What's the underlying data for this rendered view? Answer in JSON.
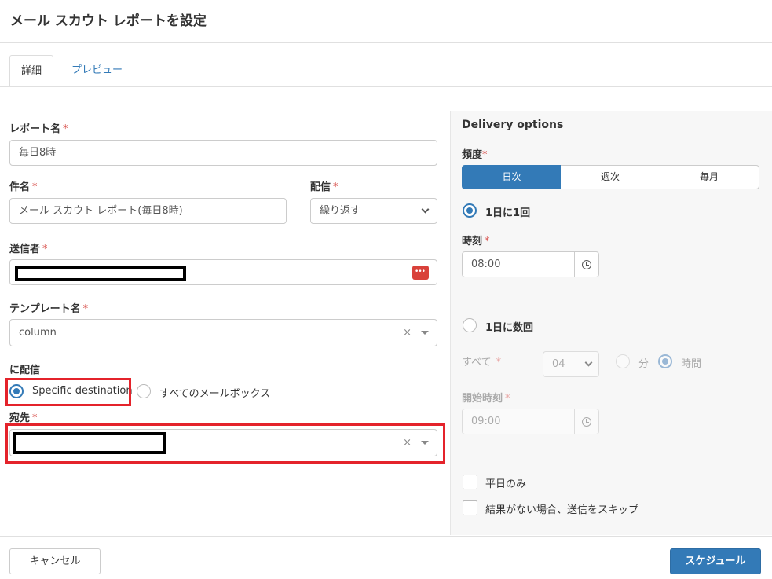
{
  "dialog": {
    "title": "メール スカウト レポートを設定"
  },
  "tabs": [
    {
      "label": "詳細",
      "active": true
    },
    {
      "label": "プレビュー",
      "active": false
    }
  ],
  "form": {
    "report_name": {
      "label": "レポート名",
      "required": "*",
      "value": "毎日8時"
    },
    "subject": {
      "label": "件名",
      "required": "*",
      "value": "メール スカウト レポート(毎日8時)"
    },
    "delivery": {
      "label": "配信",
      "required": "*",
      "value": "繰り返す"
    },
    "sender": {
      "label": "送信者",
      "required": "*",
      "value": ""
    },
    "template": {
      "label": "テンプレート名",
      "required": "*",
      "value": "column",
      "clear": "×"
    },
    "deliver_to": {
      "label": "に配信",
      "options": [
        {
          "label": "Specific destination",
          "selected": true
        },
        {
          "label": "すべてのメールボックス",
          "selected": false
        }
      ]
    },
    "destination": {
      "label": "宛先",
      "required": "*",
      "value": "",
      "clear": "×"
    }
  },
  "delivery_options": {
    "heading": "Delivery options",
    "frequency": {
      "label": "頻度",
      "required": "*",
      "options": [
        {
          "label": "日次",
          "active": true
        },
        {
          "label": "週次",
          "active": false
        },
        {
          "label": "毎月",
          "active": false
        }
      ]
    },
    "once_per_day": {
      "label": "1日に1回",
      "selected": true
    },
    "time": {
      "label": "時刻",
      "required": "*",
      "value": "08:00"
    },
    "multiple_per_day": {
      "label": "1日に数回",
      "selected": false
    },
    "every": {
      "label": "すべて",
      "required": "*",
      "value": "04",
      "units": [
        {
          "label": "分",
          "selected": false
        },
        {
          "label": "時間",
          "selected": true
        }
      ]
    },
    "start_time": {
      "label": "開始時刻",
      "required": "*",
      "value": "09:00"
    },
    "weekdays_only": {
      "label": "平日のみ",
      "checked": false
    },
    "skip_if_empty": {
      "label": "結果がない場合、送信をスキップ",
      "checked": false
    }
  },
  "footer": {
    "cancel_label": "キャンセル",
    "schedule_label": "スケジュール"
  },
  "colors": {
    "accent": "#337ab7",
    "required": "#d9534f",
    "annotation_red": "#e4232b",
    "keypass_icon": "#d9413a"
  }
}
